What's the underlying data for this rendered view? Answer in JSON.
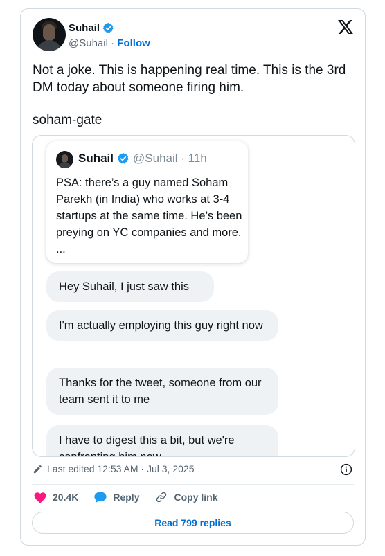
{
  "author": {
    "name": "Suhail",
    "handle": "@Suhail",
    "separator": "·",
    "follow_label": "Follow"
  },
  "tweet": {
    "line1": "Not a joke. This is happening real time. This is the 3rd DM today about someone firing him.",
    "line2": "soham-gate"
  },
  "quoted": {
    "name": "Suhail",
    "handle_time": "@Suhail · 11h",
    "body": "PSA: there’s a guy named Soham Parekh (in India) who works at 3-4 startups at the same time. He’s been preying on YC companies and more. ..."
  },
  "dm_messages": [
    "Hey Suhail, I just saw this",
    "I'm actually employing this guy right now",
    "Thanks for the tweet, someone from our team sent it to me",
    "I have to digest this a bit, but we're confronting him now"
  ],
  "footer": {
    "last_edited": "Last edited 12:53 AM · Jul 3, 2025",
    "likes": "20.4K",
    "reply_label": "Reply",
    "copy_link_label": "Copy link",
    "read_replies_label": "Read 799 replies"
  },
  "colors": {
    "link_blue": "#006fd6",
    "verified_blue": "#1d9bf0",
    "like_pink": "#f91880",
    "reply_blue": "#1d9bf0",
    "bubble_gray": "#eff2f4"
  },
  "icons": [
    "verified-badge-icon",
    "x-logo-icon",
    "pencil-icon",
    "info-icon",
    "heart-icon",
    "speech-bubble-icon",
    "link-icon"
  ]
}
